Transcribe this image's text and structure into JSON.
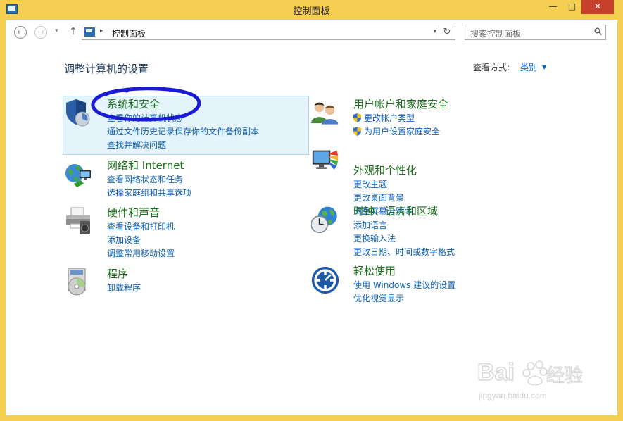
{
  "window": {
    "title": "控制面板",
    "minimize": "—",
    "maximize": "□",
    "close": "✕"
  },
  "nav": {
    "back": "←",
    "forward": "→",
    "recent": "▾",
    "up": "↑",
    "address_sep": "▸",
    "address": "控制面板",
    "address_dropdown": "▾",
    "refresh": "↻",
    "search_placeholder": "搜索控制面板"
  },
  "main": {
    "heading": "调整计算机的设置",
    "view_by_label": "查看方式:",
    "view_by_value": "类别",
    "view_by_arrow": "▼"
  },
  "categories": [
    {
      "title": "系统和安全",
      "links": [
        "查看你的计算机状态",
        "通过文件历史记录保存你的文件备份副本",
        "查找并解决问题"
      ]
    },
    {
      "title": "网络和 Internet",
      "links": [
        "查看网络状态和任务",
        "选择家庭组和共享选项"
      ]
    },
    {
      "title": "硬件和声音",
      "links": [
        "查看设备和打印机",
        "添加设备",
        "调整常用移动设置"
      ]
    },
    {
      "title": "程序",
      "links": [
        "卸载程序"
      ]
    },
    {
      "title": "用户帐户和家庭安全",
      "links": [
        "更改帐户类型",
        "为用户设置家庭安全"
      ]
    },
    {
      "title": "外观和个性化",
      "links": [
        "更改主题",
        "更改桌面背景",
        "调整屏幕分辨率"
      ]
    },
    {
      "title": "时钟、语言和区域",
      "links": [
        "添加语言",
        "更换输入法",
        "更改日期、时间或数字格式"
      ]
    },
    {
      "title": "轻松使用",
      "links": [
        "使用 Windows 建议的设置",
        "优化视觉显示"
      ]
    }
  ],
  "watermark": {
    "logo": "Bai 经验",
    "url": "jingyan.baidu.com"
  },
  "colors": {
    "titlebar": "#f5cf52",
    "category_title": "#1b6e1b",
    "link": "#0c5fb5",
    "highlight": "#e5f3fb",
    "annotation": "#1a1ad6"
  }
}
